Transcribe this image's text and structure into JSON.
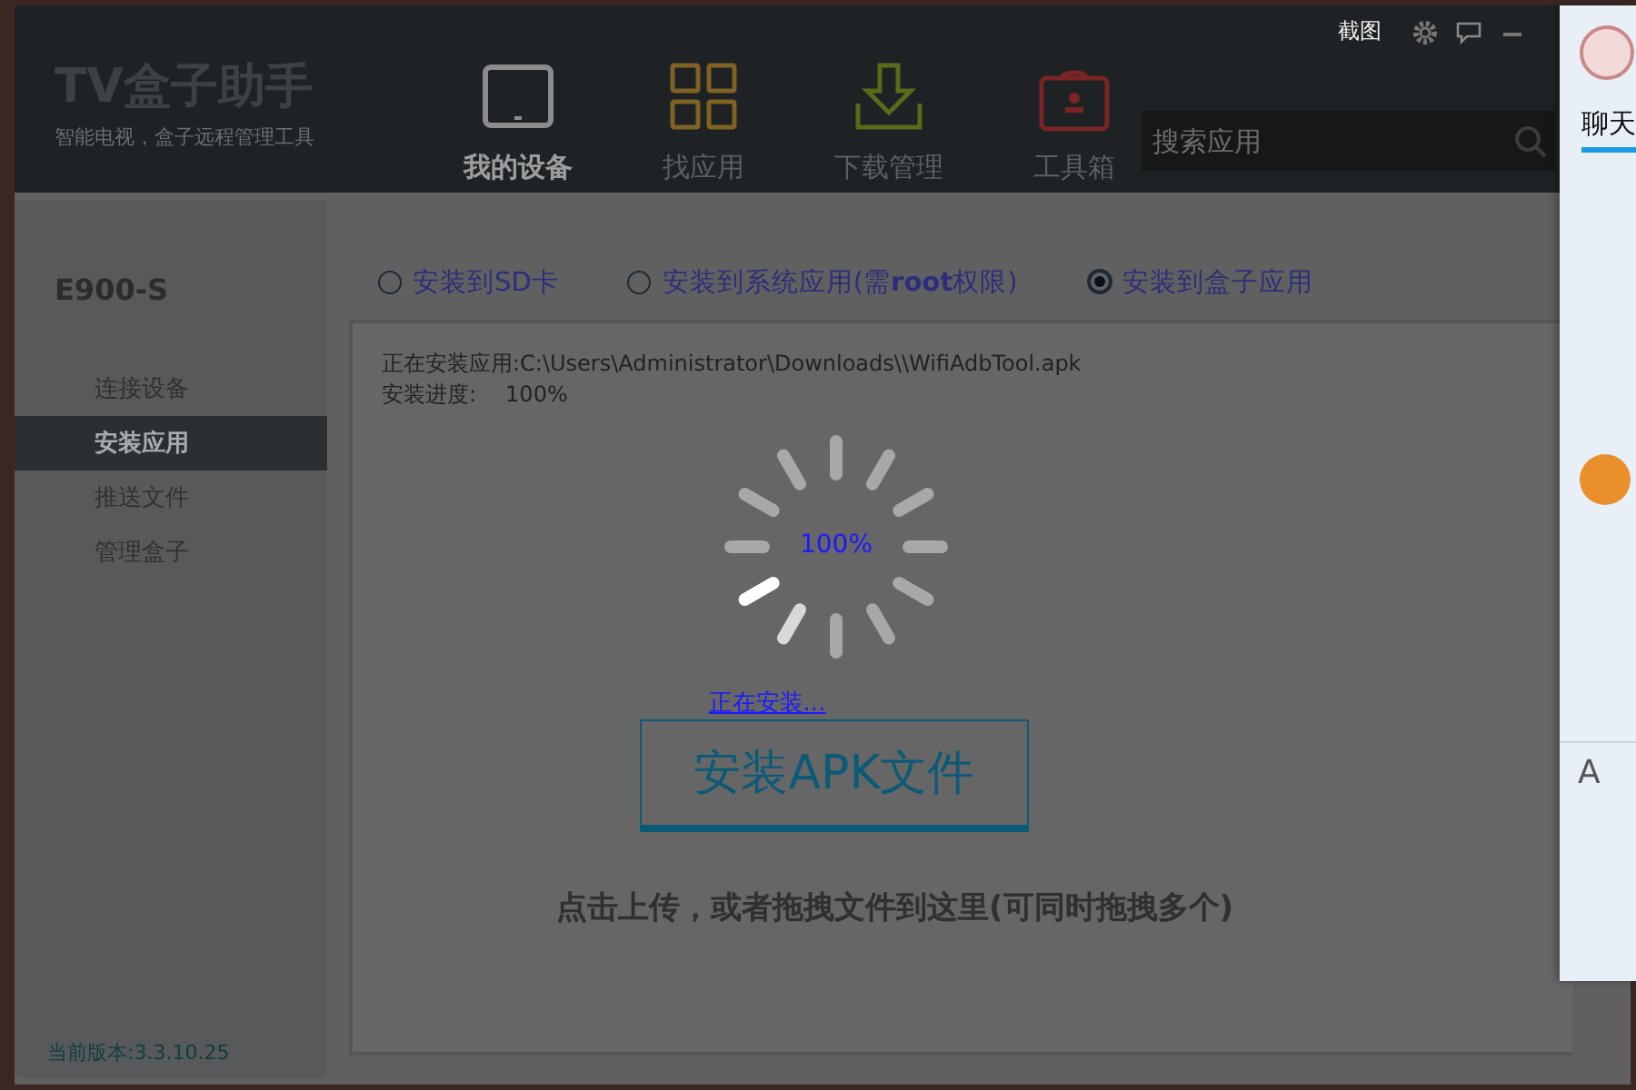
{
  "app": {
    "logo": "TV盒子助手",
    "tagline": "智能电视，盒子远程管理工具"
  },
  "nav": [
    {
      "label": "我的设备",
      "kind": "tablet",
      "selected": true
    },
    {
      "label": "找应用",
      "kind": "grid",
      "selected": false
    },
    {
      "label": "下载管理",
      "kind": "download",
      "selected": false
    },
    {
      "label": "工具箱",
      "kind": "toolbox",
      "selected": false
    }
  ],
  "title_actions": {
    "screenshot": "截图"
  },
  "search": {
    "placeholder": "搜索应用"
  },
  "device": {
    "name": "E900-S"
  },
  "sidebar": {
    "items": [
      {
        "label": "连接设备",
        "selected": false
      },
      {
        "label": "安装应用",
        "selected": true
      },
      {
        "label": "推送文件",
        "selected": false
      },
      {
        "label": "管理盒子",
        "selected": false
      }
    ]
  },
  "version": "当前版本:3.3.10.25",
  "install_targets": [
    {
      "label": "安装到SD卡",
      "selected": false
    },
    {
      "label": "安装到系统应用(需**root**权限)",
      "selected": false
    },
    {
      "label": "安装到盒子应用",
      "selected": true
    }
  ],
  "status": {
    "file_line": "正在安装应用:C:\\Users\\Administrator\\Downloads\\\\WifiAdbTool.apk",
    "progress_label": "安装进度:",
    "progress_value": "100%"
  },
  "spinner": {
    "percent": "100%",
    "caption": "正在安装..."
  },
  "install_button": "安装APK文件",
  "drop_hint": "点击上传，或者拖拽文件到这里(可同时拖拽多个)",
  "chat_panel": {
    "tab": "聊天",
    "tool_label": "A"
  }
}
